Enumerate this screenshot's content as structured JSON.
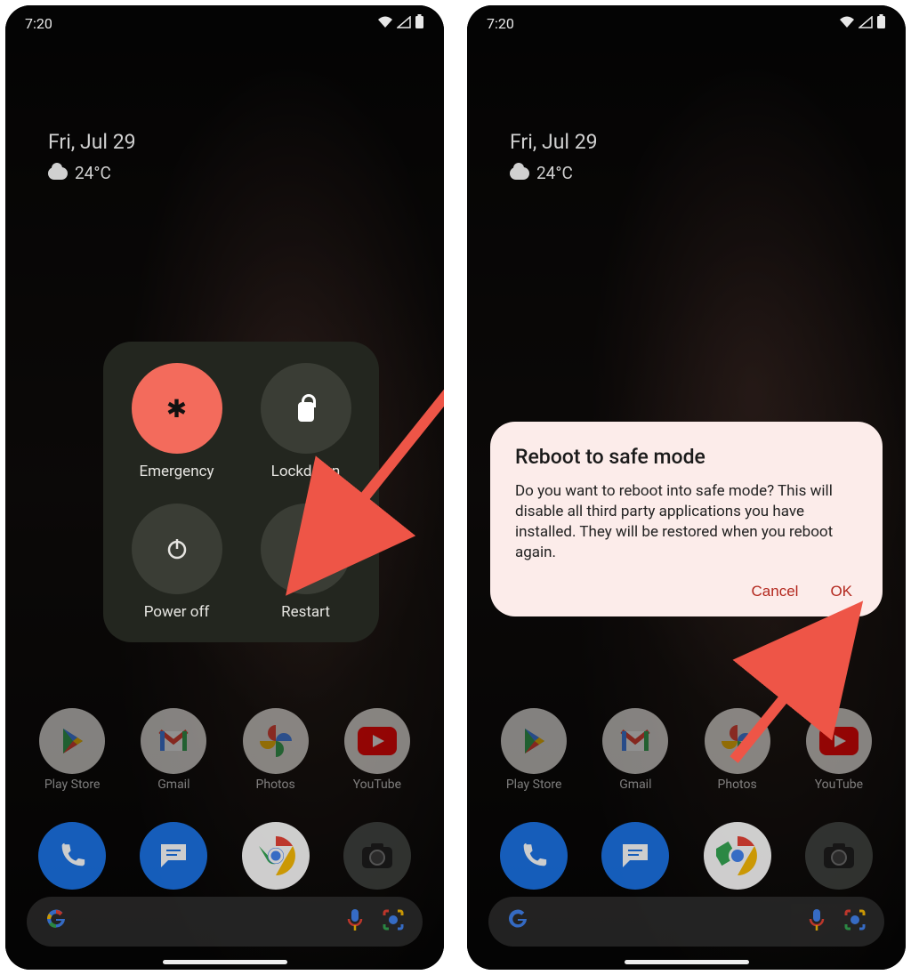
{
  "statusbar": {
    "time": "7:20"
  },
  "home": {
    "date": "Fri, Jul 29",
    "temperature": "24°C",
    "apps_row1": [
      {
        "label": "Play Store"
      },
      {
        "label": "Gmail"
      },
      {
        "label": "Photos"
      },
      {
        "label": "YouTube"
      }
    ],
    "apps_row2_labels": [
      "Phone",
      "Messages",
      "Chrome",
      "Camera"
    ]
  },
  "power_menu": {
    "items": [
      {
        "key": "emergency",
        "label": "Emergency"
      },
      {
        "key": "lockdown",
        "label": "Lockdown"
      },
      {
        "key": "poweroff",
        "label": "Power off"
      },
      {
        "key": "restart",
        "label": "Restart"
      }
    ]
  },
  "dialog": {
    "title": "Reboot to safe mode",
    "body": "Do you want to reboot into safe mode? This will disable all third party applications you have installed. They will be restored when you reboot again.",
    "cancel": "Cancel",
    "ok": "OK"
  },
  "colors": {
    "accent_red": "#f36b5c",
    "dialog_bg": "#fcecea",
    "action_text": "#b3281e"
  }
}
